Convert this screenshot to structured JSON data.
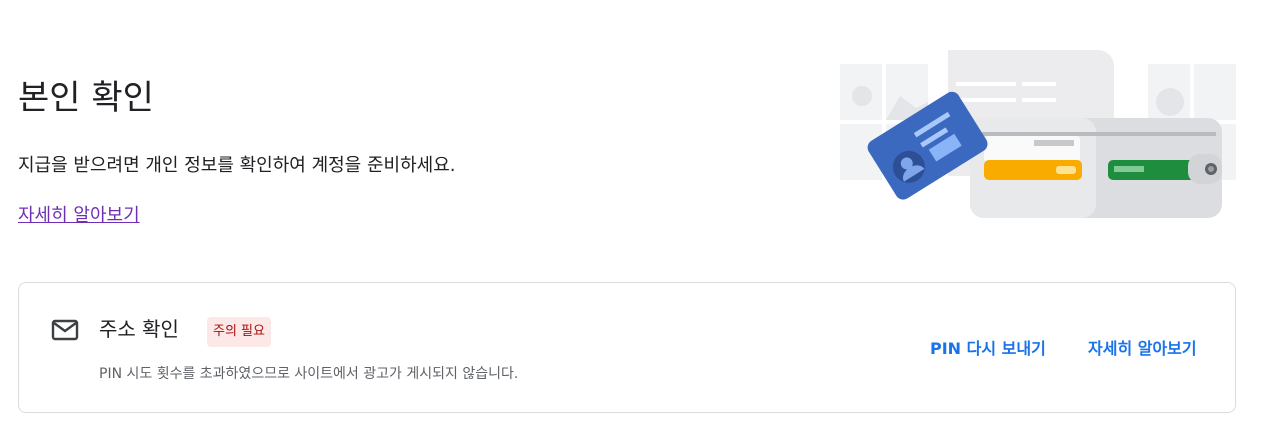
{
  "header": {
    "title": "본인 확인",
    "description": "지급을 받으려면 개인 정보를 확인하여 계정을 준비하세요.",
    "learn_more": "자세히 알아보기"
  },
  "address_card": {
    "icon": "mail-icon",
    "title": "주소 확인",
    "badge": "주의 필요",
    "description": "PIN 시도 횟수를 초과하였으므로 사이트에서 광고가 게시되지 않습니다.",
    "resend_pin": "PIN 다시 보내기",
    "learn_more": "자세히 알아보기"
  },
  "colors": {
    "link_purple": "#6f2fb4",
    "action_blue": "#1a73e8",
    "badge_bg": "#fce8e6",
    "badge_text": "#a50e0e"
  }
}
